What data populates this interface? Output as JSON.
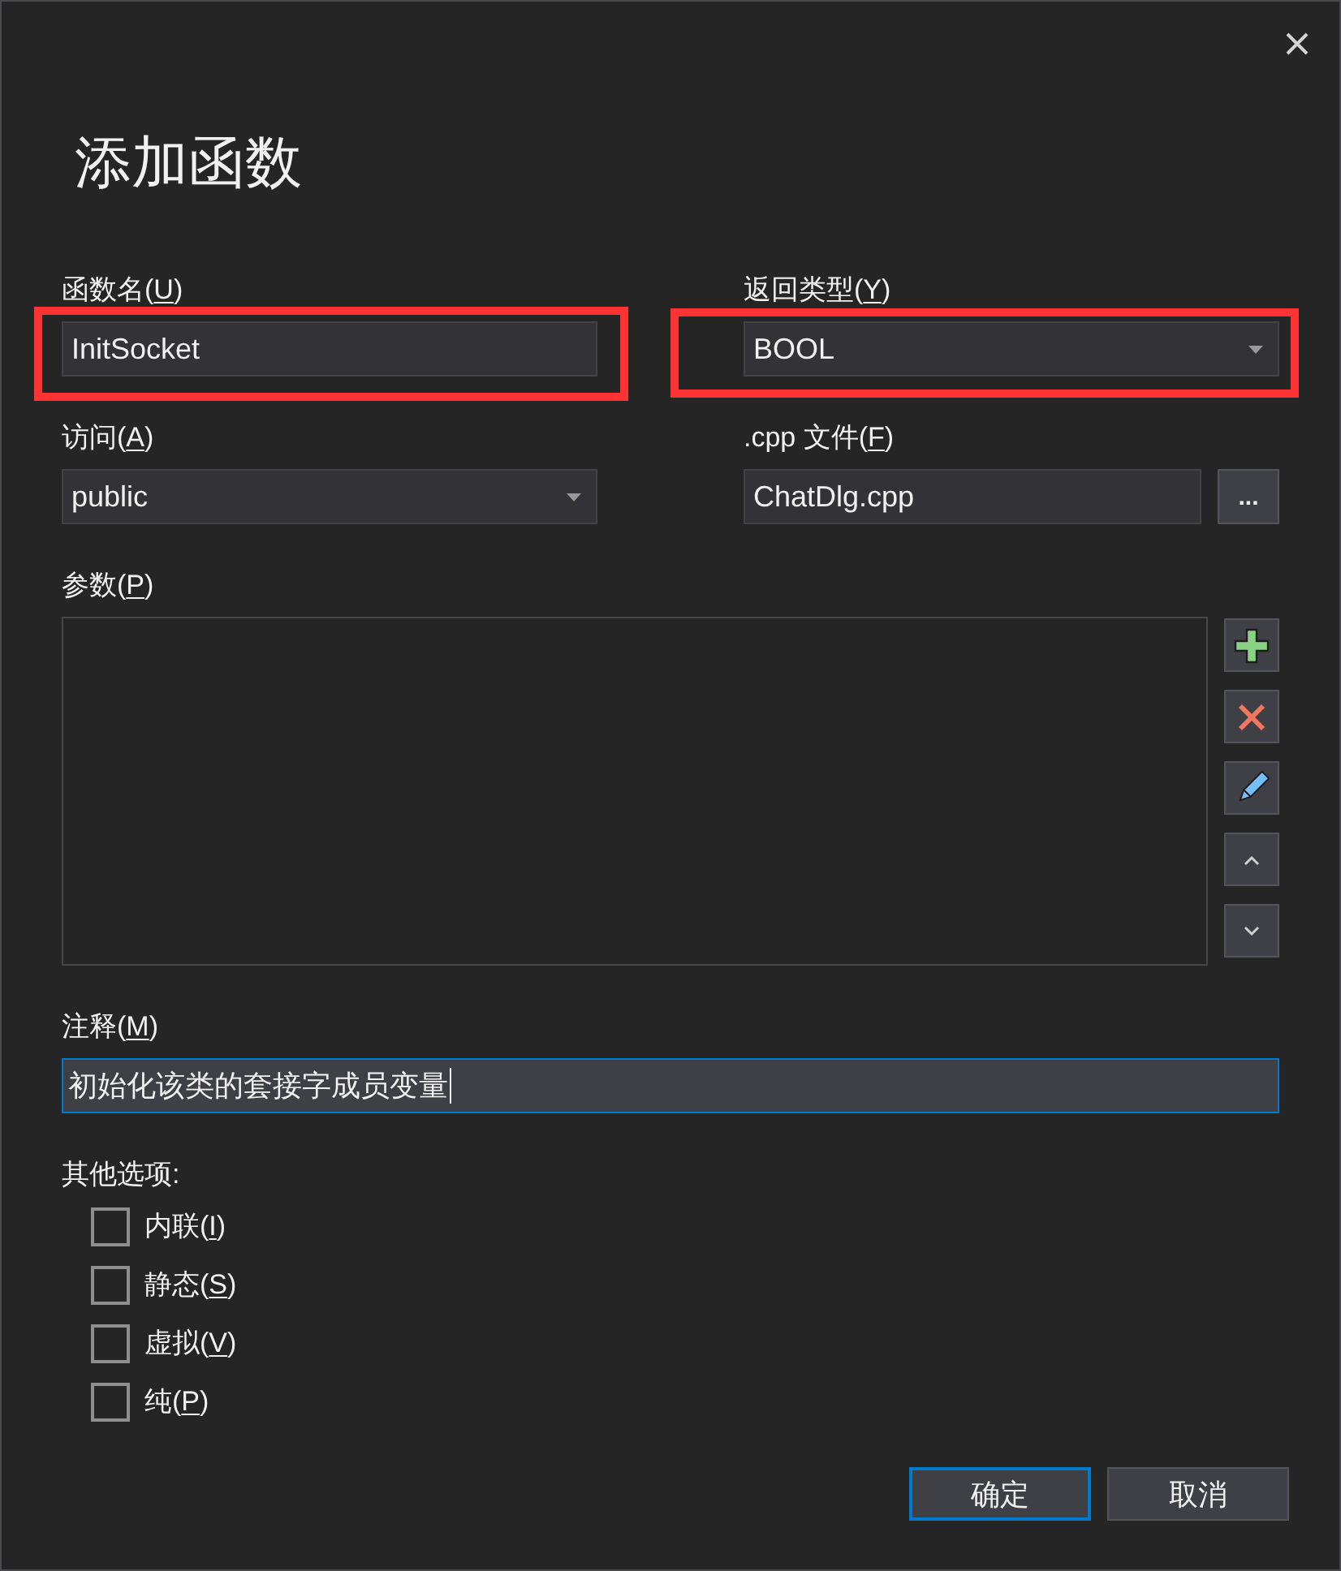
{
  "dialog": {
    "title": "添加函数"
  },
  "fields": [
    {
      "kind": "text",
      "label": {
        "before": "函数名(",
        "access_key": "U",
        "after": ")"
      },
      "value": "InitSocket",
      "highlighted": true
    },
    {
      "kind": "dropdown",
      "label": {
        "before": "返回类型(",
        "access_key": "Y",
        "after": ")"
      },
      "value": "BOOL",
      "highlighted": true
    },
    {
      "kind": "dropdown",
      "label": {
        "before": "访问(",
        "access_key": "A",
        "after": ")"
      },
      "value": "public",
      "highlighted": false
    },
    {
      "kind": "file",
      "label": {
        "before": ".cpp 文件(",
        "access_key": "F",
        "after": ")"
      },
      "value": "ChatDlg.cpp",
      "browse_button": "...",
      "highlighted": false
    }
  ],
  "parameters": {
    "label": {
      "before": "参数(",
      "access_key": "P",
      "after": ")"
    },
    "buttons": [
      {
        "kind": "add"
      },
      {
        "kind": "remove"
      },
      {
        "kind": "edit"
      },
      {
        "kind": "move_up"
      },
      {
        "kind": "move_down"
      }
    ]
  },
  "comment": {
    "label": {
      "before": "注释(",
      "access_key": "M",
      "after": ")"
    },
    "value": "初始化该类的套接字成员变量",
    "focused": true
  },
  "other_options": {
    "heading": "其他选项:",
    "options": [
      {
        "label": {
          "before": "内联(",
          "access_key": "I",
          "after": ")"
        },
        "checked": false
      },
      {
        "label": {
          "before": "静态(",
          "access_key": "S",
          "after": ")"
        },
        "checked": false
      },
      {
        "label": {
          "before": "虚拟(",
          "access_key": "V",
          "after": ")"
        },
        "checked": false
      },
      {
        "label": {
          "before": "纯(",
          "access_key": "P",
          "after": ")"
        },
        "checked": false
      }
    ]
  },
  "buttons": [
    {
      "label": "确定",
      "default": true
    },
    {
      "label": "取消",
      "default": false
    }
  ]
}
